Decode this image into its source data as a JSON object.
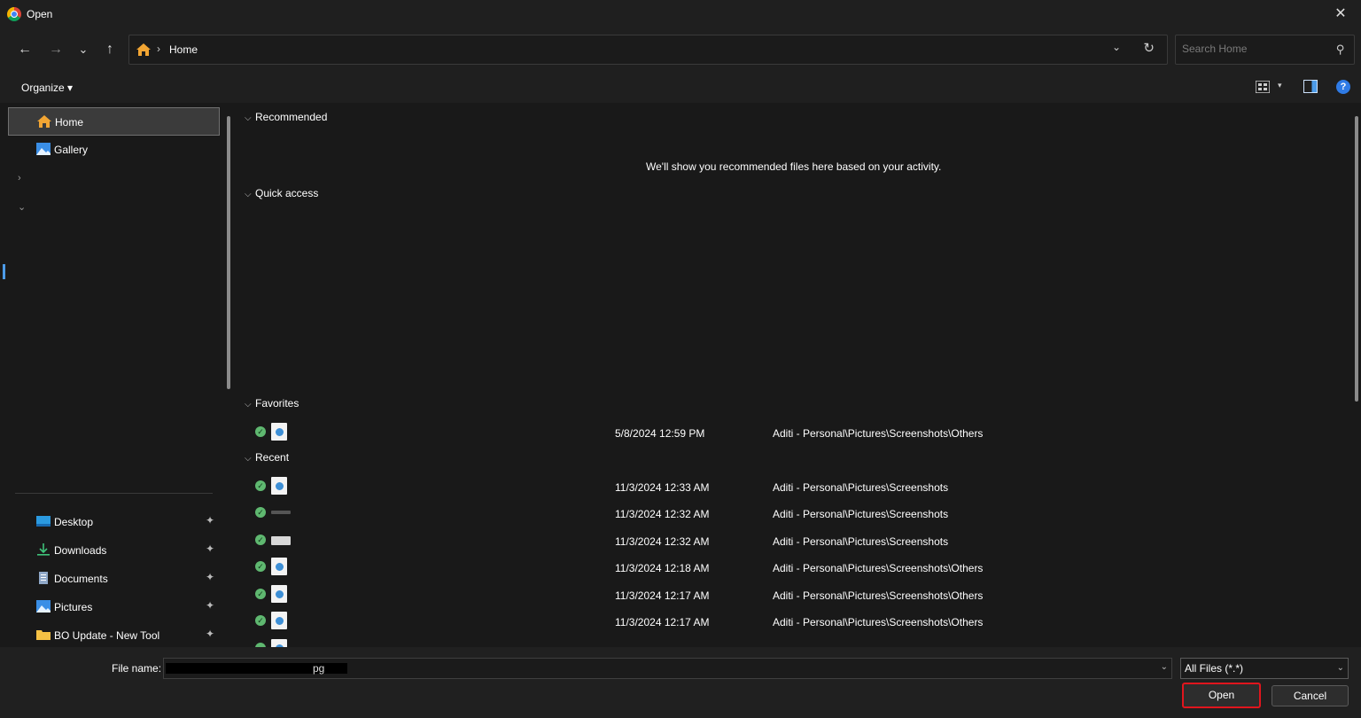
{
  "window": {
    "title": "Open",
    "close_glyph": "✕",
    "app_icon": "chrome-icon"
  },
  "nav": {
    "back": "←",
    "forward": "→",
    "recent": "⌄",
    "up": "↑",
    "breadcrumb": "Home",
    "dropdown": "⌄",
    "refresh": "↻",
    "search_placeholder": "Search Home"
  },
  "commandbar": {
    "organize_label": "Organize ▾",
    "view_dropdown": "▾",
    "help": "?"
  },
  "sidebar": {
    "top_items": [
      {
        "label": "Home",
        "icon": "home-icon",
        "selected": true
      },
      {
        "label": "Gallery",
        "icon": "gallery-icon"
      }
    ],
    "chevrons": [
      "›",
      "⌄"
    ],
    "pinned_items": [
      {
        "label": "Desktop",
        "icon": "desktop-icon",
        "pin": "📌"
      },
      {
        "label": "Downloads",
        "icon": "download-icon",
        "pin": "📌"
      },
      {
        "label": "Documents",
        "icon": "documents-icon",
        "pin": "📌"
      },
      {
        "label": "Pictures",
        "icon": "pictures-icon",
        "pin": "📌"
      },
      {
        "label": "BO Update - New Tool",
        "icon": "folder-icon",
        "pin": "📌"
      }
    ]
  },
  "content": {
    "sections": {
      "recommended": "Recommended",
      "recommended_empty": "We'll show you recommended files here based on your activity.",
      "quick_access": "Quick access",
      "favorites": "Favorites",
      "recent": "Recent"
    },
    "caret": "⌵",
    "status_glyph": "✓",
    "favorites": [
      {
        "date": "5/8/2024 12:59 PM",
        "path": "Aditi - Personal\\Pictures\\Screenshots\\Others",
        "thumb": "image"
      }
    ],
    "recent": [
      {
        "date": "11/3/2024 12:33 AM",
        "path": "Aditi - Personal\\Pictures\\Screenshots",
        "thumb": "image"
      },
      {
        "date": "11/3/2024 12:32 AM",
        "path": "Aditi - Personal\\Pictures\\Screenshots",
        "thumb": "dim"
      },
      {
        "date": "11/3/2024 12:32 AM",
        "path": "Aditi - Personal\\Pictures\\Screenshots",
        "thumb": "flat"
      },
      {
        "date": "11/3/2024 12:18 AM",
        "path": "Aditi - Personal\\Pictures\\Screenshots\\Others",
        "thumb": "image"
      },
      {
        "date": "11/3/2024 12:17 AM",
        "path": "Aditi - Personal\\Pictures\\Screenshots\\Others",
        "thumb": "image"
      },
      {
        "date": "11/3/2024 12:17 AM",
        "path": "Aditi - Personal\\Pictures\\Screenshots\\Others",
        "thumb": "image"
      }
    ]
  },
  "footer": {
    "file_name_label": "File name:",
    "file_name_value": "pg",
    "dropdown": "⌄",
    "file_type": "All Files (*.*)",
    "open_label": "Open",
    "cancel_label": "Cancel"
  },
  "colors": {
    "background": "#191919",
    "chrome": "#1f1f1f",
    "accent": "#4c9be8",
    "highlight": "#e0151d",
    "status": "#5fb870"
  }
}
